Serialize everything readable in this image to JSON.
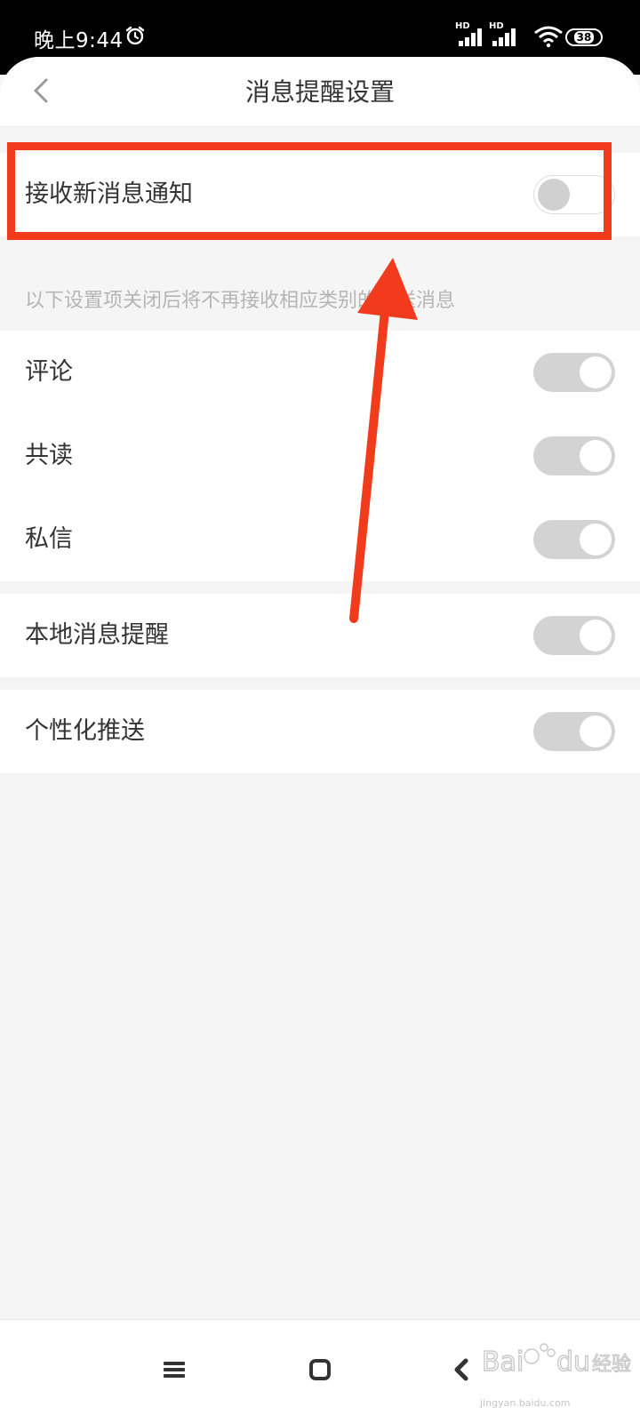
{
  "status_bar": {
    "time": "晚上9:44",
    "signal_labels": [
      "HD",
      "HD"
    ],
    "battery": "38",
    "icons": [
      "alarm-icon",
      "signal-icon",
      "wifi-icon",
      "battery-icon"
    ]
  },
  "header": {
    "title": "消息提醒设置",
    "back_icon": "chevron-left-icon"
  },
  "main_setting": {
    "label": "接收新消息通知",
    "toggle": "off"
  },
  "hint": "以下设置项关闭后将不再接收相应类别的推送消息",
  "items": [
    {
      "label": "评论",
      "toggle": "on"
    },
    {
      "label": "共读",
      "toggle": "on"
    },
    {
      "label": "私信",
      "toggle": "on"
    }
  ],
  "local_reminder": {
    "label": "本地消息提醒",
    "toggle": "on"
  },
  "personalized_push": {
    "label": "个性化推送",
    "toggle": "on"
  },
  "navbar": {
    "icons": [
      "menu-icon",
      "home-icon",
      "back-icon"
    ]
  },
  "watermark": {
    "brand": "Baidu 经验",
    "url": "jingyan.baidu.com"
  },
  "colors": {
    "annotation": "#f23a1c",
    "toggle_on": "#d3d3d3",
    "page_bg": "#f5f5f5"
  }
}
